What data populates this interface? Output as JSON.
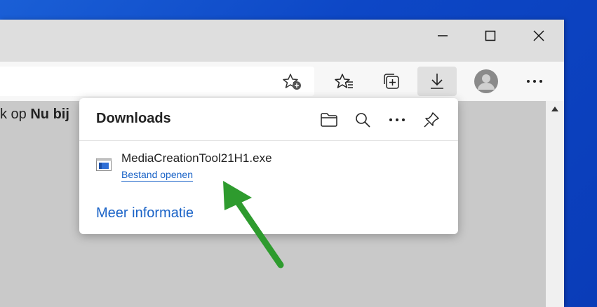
{
  "window": {
    "controls": [
      "minimize",
      "maximize",
      "close"
    ]
  },
  "toolbar": {
    "icons": [
      "favorite-add-icon",
      "favorites-icon",
      "collections-icon",
      "download-icon",
      "avatar",
      "more-icon"
    ]
  },
  "page": {
    "text_visible": "k op ",
    "text_bold": "Nu bij"
  },
  "downloads_panel": {
    "title": "Downloads",
    "item": {
      "filename": "MediaCreationTool21H1.exe",
      "action": "Bestand openen"
    },
    "more_info": "Meer informatie"
  },
  "colors": {
    "link": "#1a63c7",
    "arrow": "#2e9b2e",
    "desktop": "#1a5fd6"
  }
}
